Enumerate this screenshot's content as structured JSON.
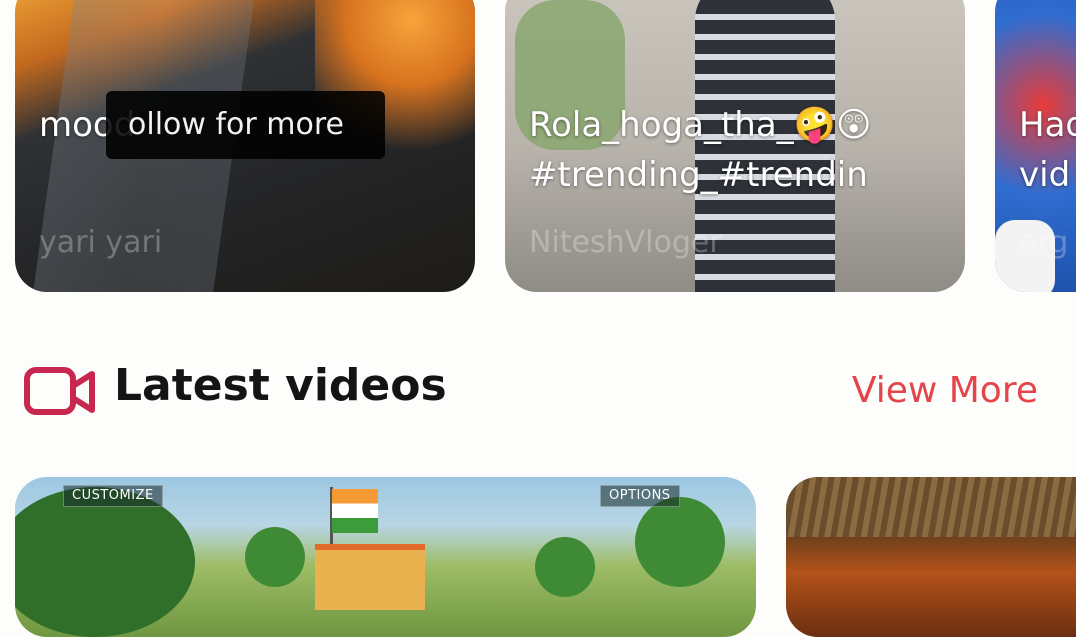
{
  "cards": [
    {
      "title": "mood",
      "subtitle": "yari yari"
    },
    {
      "title_line1": "Rola_hoga_tha_🤪😲",
      "title_line2": "#trending_#trendin",
      "subtitle": "NiteshVloger"
    },
    {
      "title_line1": "Had",
      "title_line2": "vid",
      "subtitle": "arg"
    }
  ],
  "tooltip": {
    "text": "ollow for more"
  },
  "section": {
    "title": "Latest videos",
    "view_more": "View More",
    "icon": "video-camera-icon",
    "accent": "#c8284f",
    "link_color": "#e3454a"
  },
  "latest": [
    {
      "hud_left": "CUSTOMIZE",
      "hud_right": "OPTIONS"
    },
    {}
  ]
}
